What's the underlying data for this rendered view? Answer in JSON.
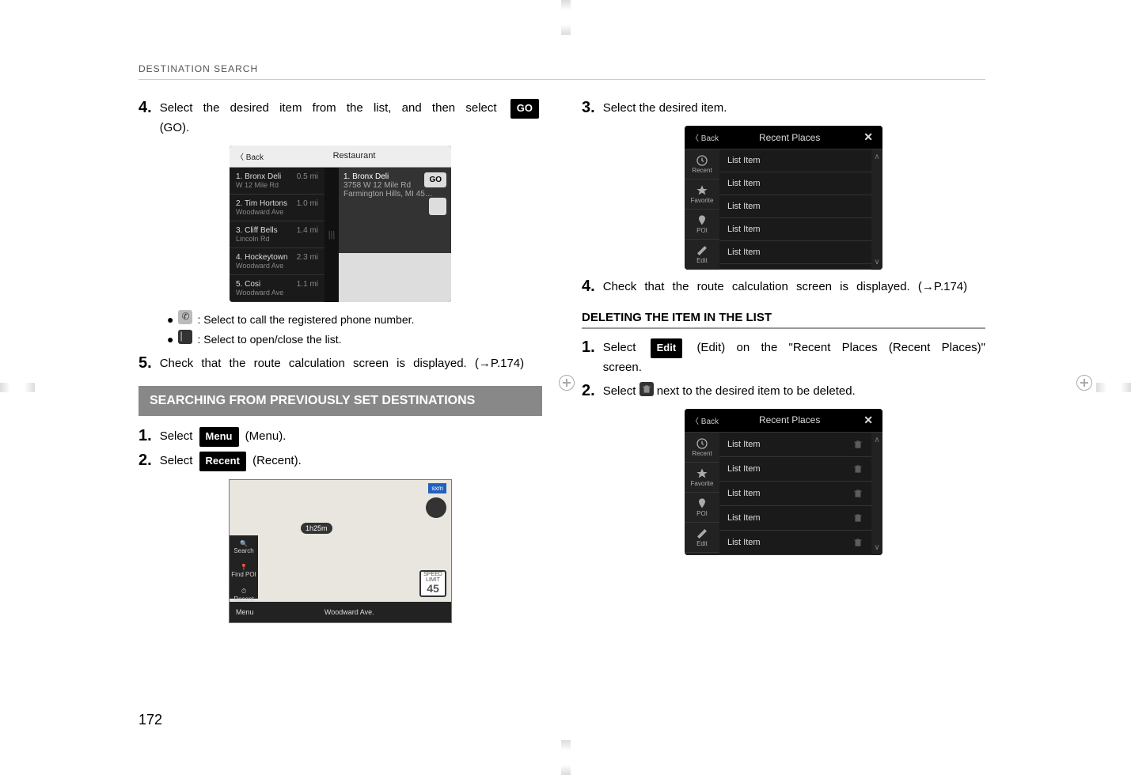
{
  "breadcrumb": "DESTINATION SEARCH",
  "page_number": "172",
  "left": {
    "step4_pre": "Select  the  desired  item  from  the  list,  and  then  select ",
    "go_label": "GO",
    "step4_post": " (GO).",
    "restaurant_ss": {
      "back": "Back",
      "title": "Restaurant",
      "go": "GO",
      "rows": [
        {
          "n": "1. Bronx Deli",
          "sub": "W 12 Mile Rd",
          "dist": "0.5 mi"
        },
        {
          "n": "2. Tim Hortons",
          "sub": "Woodward Ave",
          "dist": "1.0 mi"
        },
        {
          "n": "3. Cliff Bells",
          "sub": "Lincoln Rd",
          "dist": "1.4 mi"
        },
        {
          "n": "4. Hockeytown",
          "sub": "Woodward Ave",
          "dist": "2.3 mi"
        },
        {
          "n": "5. Cosi",
          "sub": "Woodward Ave",
          "dist": "1.1 mi"
        }
      ],
      "panel_title": "1. Bronx Deli",
      "panel_addr1": "3758 W 12 Mile Rd",
      "panel_addr2": "Farmington Hills, MI 45…"
    },
    "bullet1": ": Select to call the registered phone number.",
    "bullet2": ": Select to open/close the list.",
    "step5": "Check  that  the  route  calculation  screen  is  displayed. (→P.174)",
    "section_title": "SEARCHING FROM PREVIOUSLY SET DESTINATIONS",
    "s1_pre": "Select ",
    "menu_label": "Menu",
    "s1_post": " (Menu).",
    "s2_pre": "Select ",
    "recent_label": "Recent",
    "s2_post": " (Recent).",
    "map_ss": {
      "sxm": "sxm",
      "eta": "1h25m",
      "speed_top": "SPEED LIMIT",
      "speed": "45",
      "bottom_name": "Woodward Ave.",
      "tray": [
        "Search",
        "Find POI",
        "Recent",
        "Menu"
      ]
    }
  },
  "right": {
    "step3": "Select the desired item.",
    "recent_ss": {
      "back": "Back",
      "title": "Recent Places",
      "close": "✕",
      "side": [
        "Recent",
        "Favorite",
        "POI"
      ],
      "edit": "Edit",
      "items": [
        "List Item",
        "List Item",
        "List Item",
        "List Item",
        "List Item"
      ]
    },
    "step4": "Check  that  the  route  calculation  screen  is  displayed. (→P.174)",
    "subsection": "DELETING THE ITEM IN THE LIST",
    "d1_pre": "Select  ",
    "edit_label": "Edit",
    "d1_post": "  (Edit)  on  the  \"Recent  Places  (Recent Places)\" screen.",
    "d2_pre": "Select ",
    "d2_post": " next to the desired item to be deleted.",
    "recent_ss2": {
      "back": "Back",
      "title": "Recent Places",
      "close": "✕",
      "side": [
        "Recent",
        "Favorite",
        "POI"
      ],
      "edit": "Edit",
      "items": [
        "List Item",
        "List Item",
        "List Item",
        "List Item",
        "List Item"
      ]
    }
  },
  "nums": {
    "s3": "3.",
    "s4": "4.",
    "s5": "5.",
    "s1": "1.",
    "s2": "2."
  }
}
